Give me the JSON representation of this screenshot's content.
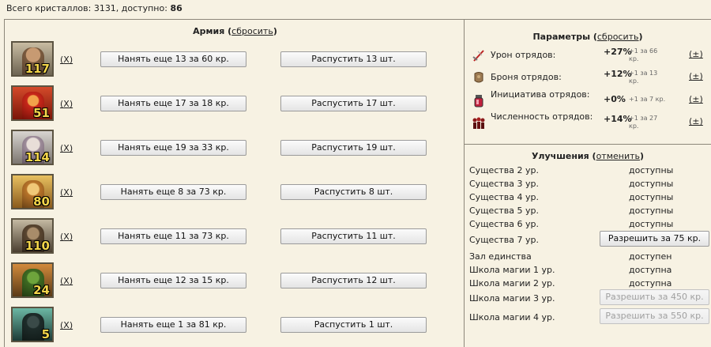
{
  "top": {
    "prefix": "Всего кристаллов: 3131, доступно:",
    "available": "86"
  },
  "army": {
    "title": "Армия",
    "reset_link": "сбросить",
    "remove_label": "(X)",
    "rows": [
      {
        "count": "117",
        "hire": "Нанять еще 13 за 60 кр.",
        "dismiss": "Распустить 13 шт."
      },
      {
        "count": "51",
        "hire": "Нанять еще 17 за 18 кр.",
        "dismiss": "Распустить 17 шт."
      },
      {
        "count": "114",
        "hire": "Нанять еще 19 за 33 кр.",
        "dismiss": "Распустить 19 шт."
      },
      {
        "count": "80",
        "hire": "Нанять еще 8 за 73 кр.",
        "dismiss": "Распустить 8 шт."
      },
      {
        "count": "110",
        "hire": "Нанять еще 11 за 73 кр.",
        "dismiss": "Распустить 11 шт."
      },
      {
        "count": "24",
        "hire": "Нанять еще 12 за 15 кр.",
        "dismiss": "Распустить 12 шт."
      },
      {
        "count": "5",
        "hire": "Нанять еще 1 за 81 кр.",
        "dismiss": "Распустить 1 шт."
      }
    ]
  },
  "params": {
    "title": "Параметры",
    "reset_link": "сбросить",
    "plusminus": "(±)",
    "rows": [
      {
        "label": "Урон отрядов:",
        "value": "+27%",
        "cost1": "+1 за 66",
        "cost2": "кр.",
        "icon": "sword-icon"
      },
      {
        "label": "Броня отрядов:",
        "value": "+12%",
        "cost1": "+1 за 13",
        "cost2": "кр.",
        "icon": "armor-icon"
      },
      {
        "label": "Инициатива отрядов:",
        "value": "+0%",
        "cost1": "+1 за 7 кр.",
        "cost2": "",
        "icon": "potion-icon"
      },
      {
        "label": "Численность отрядов:",
        "value": "+14%",
        "cost1": "+1 за 27",
        "cost2": "кр.",
        "icon": "crowd-icon"
      }
    ]
  },
  "upgrades": {
    "title": "Улучшения",
    "cancel_link": "отменить",
    "rows": [
      {
        "name": "Существа 2 ур.",
        "status": "доступны"
      },
      {
        "name": "Существа 3 ур.",
        "status": "доступны"
      },
      {
        "name": "Существа 4 ур.",
        "status": "доступны"
      },
      {
        "name": "Существа 5 ур.",
        "status": "доступны"
      },
      {
        "name": "Существа 6 ур.",
        "status": "доступны"
      },
      {
        "name": "Существа 7 ур.",
        "button": "Разрешить за 75 кр.",
        "enabled": true
      },
      {
        "name": "Зал единства",
        "status": "доступен"
      },
      {
        "name": "Школа магии 1 ур.",
        "status": "доступна"
      },
      {
        "name": "Школа магии 2 ур.",
        "status": "доступна"
      },
      {
        "name": "Школа магии 3 ур.",
        "button": "Разрешить за 450 кр.",
        "enabled": false
      },
      {
        "name": "Школа магии 4 ур.",
        "button": "Разрешить за 550 кр.",
        "enabled": false
      }
    ]
  },
  "colors": {
    "background": "#f7f2e3",
    "border": "#8d877a",
    "count_text": "#f3d54a"
  }
}
